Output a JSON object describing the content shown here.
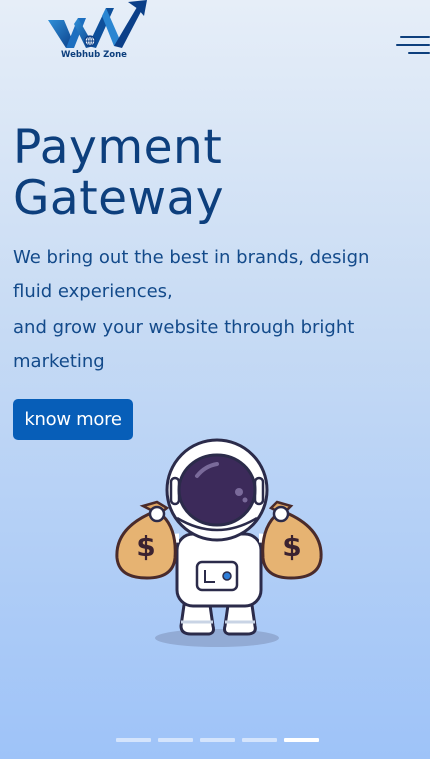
{
  "header": {
    "logo_text": "Webhub Zone",
    "menu_icon": "hamburger-menu-icon"
  },
  "hero": {
    "title_line1": "Payment",
    "title_line2": "Gateway",
    "desc_1": "We bring out the best in brands, design fluid experiences,",
    "desc_2": "and grow your website through bright marketing",
    "button_label": "know more",
    "illustration": "astronaut-money-bags-illustration"
  },
  "carousel": {
    "slide_count": 5,
    "active_index": 4
  },
  "colors": {
    "accent": "#075eb8",
    "text_primary": "#0d3f7d",
    "gradient_top": "#e6eef8",
    "gradient_bottom": "#9ec3f8"
  }
}
